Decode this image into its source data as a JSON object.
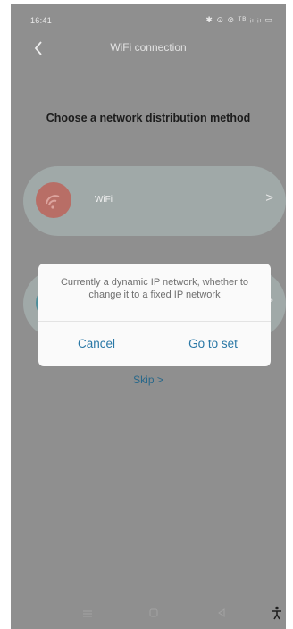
{
  "status_bar": {
    "time": "16:41",
    "icons_text": "✱ ⊙ ⊘ ᵀᴮ ᵢₗ ᵢₗ ▭",
    "icon_names": [
      "bluetooth-icon",
      "location-icon",
      "alarm-icon",
      "data-icon",
      "signal-icon",
      "signal-icon",
      "battery-icon"
    ]
  },
  "header": {
    "title": "WiFi connection",
    "back_icon": "chevron-left-icon"
  },
  "main": {
    "section_title": "Choose a network distribution method",
    "options": [
      {
        "label": "WiFi",
        "icon": "wifi-icon",
        "chevron": ">"
      },
      {
        "label": "",
        "icon": "network-icon",
        "chevron": ">"
      }
    ],
    "skip_label": "Skip >"
  },
  "dialog": {
    "message": "Currently a dynamic IP network, whether to change it to a fixed IP network",
    "cancel_label": "Cancel",
    "confirm_label": "Go to set"
  },
  "nav_bar": {
    "icons": [
      "menu-icon",
      "home-icon",
      "back-icon",
      "accessibility-icon"
    ]
  },
  "colors": {
    "overlay_background": "#8f8f8f",
    "dialog_button": "#2a78a6",
    "skip_link": "#28688a"
  }
}
